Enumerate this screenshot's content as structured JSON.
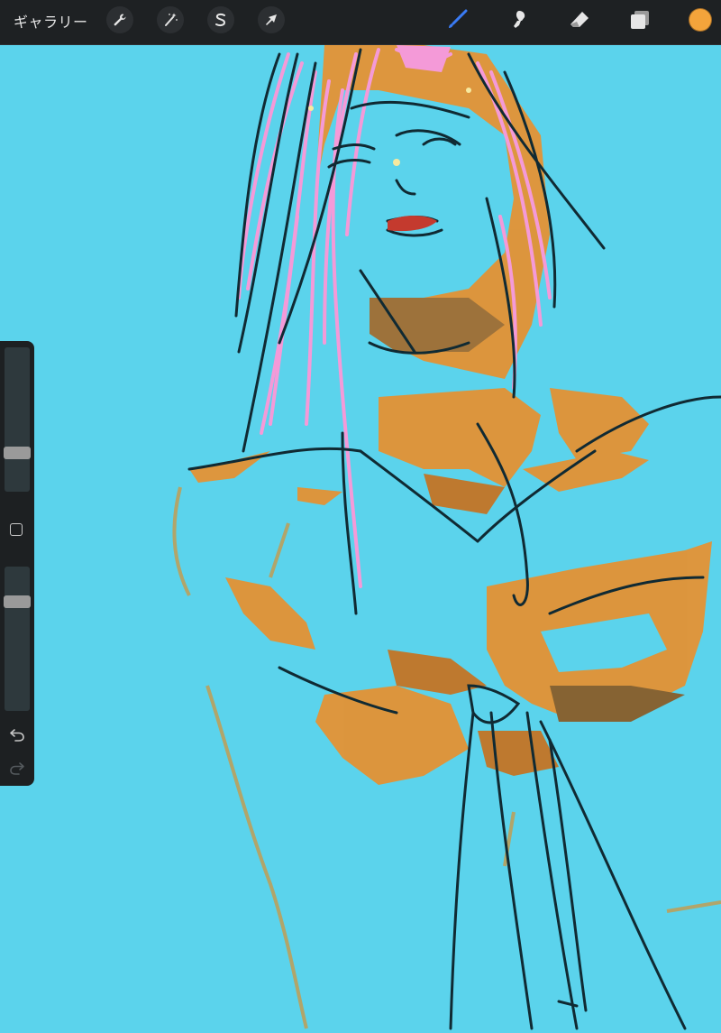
{
  "app": {
    "canvas_background": "#5bd3ec",
    "toolbar_background": "#1e2123"
  },
  "toolbar": {
    "gallery_label": "ギャラリー",
    "actions": [
      {
        "name": "actions-wrench",
        "icon": "wrench-icon"
      },
      {
        "name": "adjustments",
        "icon": "magic-wand-icon"
      },
      {
        "name": "selection",
        "icon": "selection-s-icon"
      },
      {
        "name": "transform",
        "icon": "arrow-cursor-icon"
      }
    ],
    "paint_tools": [
      {
        "name": "brush",
        "icon": "brush-icon",
        "active": true,
        "active_color": "#3a7bf4"
      },
      {
        "name": "smudge",
        "icon": "smudge-icon",
        "active": false
      },
      {
        "name": "eraser",
        "icon": "eraser-icon",
        "active": false
      },
      {
        "name": "layers",
        "icon": "layers-icon",
        "active": false
      }
    ],
    "current_color": "#f4a43b"
  },
  "sidebar": {
    "brush_size_level": 0.25,
    "opacity_level": 0.78,
    "icons": {
      "modify": "square-icon",
      "undo": "undo-icon",
      "redo": "redo-icon"
    }
  },
  "artwork": {
    "palette": {
      "skin_shadow": "#e8902f",
      "hair": "#f49ad8",
      "line": "#102a33",
      "background": "#5bd3ec"
    }
  }
}
